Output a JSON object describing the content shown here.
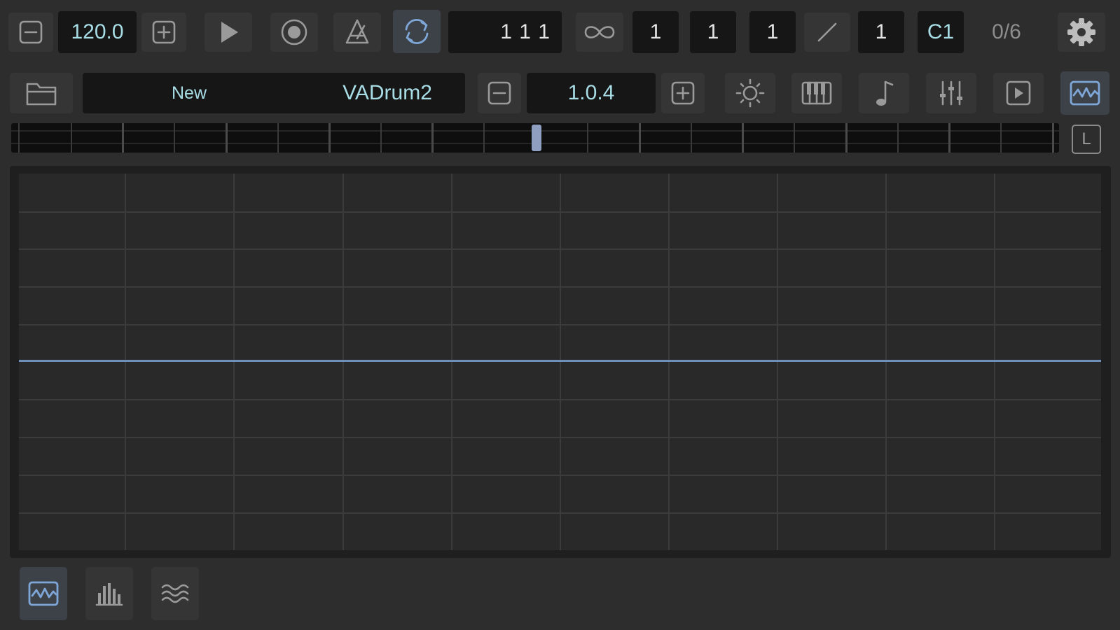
{
  "transport": {
    "tempo": "120.0",
    "position": "1  1 1",
    "loop_bars": "1",
    "time_sig_num": "1",
    "time_sig_den": "1",
    "quantize": "1",
    "note": "C1",
    "voices": "0/6"
  },
  "preset": {
    "bank": "New",
    "name": "VADrum2",
    "version": "1.0.4"
  },
  "ruler": {
    "lock_label": "L",
    "playhead_position": 0.5
  },
  "icons": {
    "minus": "minus-square-icon",
    "plus": "plus-square-icon",
    "play": "play-icon",
    "record": "record-icon",
    "metronome": "metronome-icon",
    "loop": "loop-icon",
    "infinity": "infinity-icon",
    "slash": "slash-icon",
    "gear": "gear-icon",
    "folder": "folder-icon",
    "sun": "sun-icon",
    "keyboard": "piano-keyboard-icon",
    "note": "music-note-icon",
    "mixer": "mixer-sliders-icon",
    "play_box": "play-box-icon",
    "waveform": "waveform-icon",
    "bars": "bar-graph-icon",
    "waves": "waves-icon"
  },
  "colors": {
    "accent": "#7ea7d8",
    "field_text": "#a8dde6",
    "background": "#2d2d2e"
  }
}
